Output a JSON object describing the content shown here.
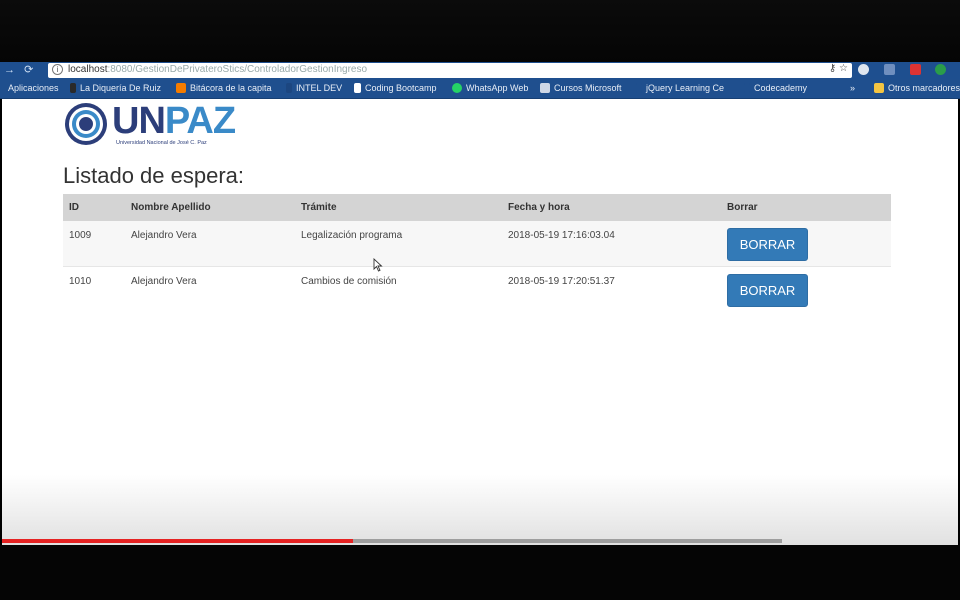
{
  "browser": {
    "url_host": "localhost",
    "url_path": ":8080/GestionDePrivateroStics/ControladorGestionIngreso",
    "bookmarks": [
      {
        "label": "Aplicaciones",
        "icon": "apps-grid-icon"
      },
      {
        "label": "La Diquería De Ruiz",
        "icon": "bookmark-icon"
      },
      {
        "label": "Bitácora de la capita",
        "icon": "blogger-icon"
      },
      {
        "label": "INTEL DEV",
        "icon": "intel-icon"
      },
      {
        "label": "Coding Bootcamp",
        "icon": "page-icon"
      },
      {
        "label": "WhatsApp Web",
        "icon": "whatsapp-icon"
      },
      {
        "label": "Cursos Microsoft",
        "icon": "microsoft-icon"
      },
      {
        "label": "jQuery Learning Ce",
        "icon": "jquery-icon"
      },
      {
        "label": "Codecademy",
        "icon": "codecademy-icon"
      },
      {
        "label": "»",
        "icon": ""
      },
      {
        "label": "Otros marcadores",
        "icon": "folder-icon"
      }
    ]
  },
  "logo": {
    "unpaz_un": "UN",
    "unpaz_paz": "PAZ",
    "subtitle": "Universidad Nacional de José C. Paz"
  },
  "page": {
    "title": "Listado de espera:"
  },
  "table": {
    "headers": [
      "ID",
      "Nombre Apellido",
      "Trámite",
      "Fecha y hora",
      "Borrar"
    ],
    "rows": [
      {
        "id": "1009",
        "name": "Alejandro Vera",
        "tramite": "Legalización programa",
        "fecha": "2018-05-19 17:16:03.04",
        "button": "BORRAR"
      },
      {
        "id": "1010",
        "name": "Alejandro Vera",
        "tramite": "Cambios de comisión",
        "fecha": "2018-05-19 17:20:51.37",
        "button": "BORRAR"
      }
    ]
  },
  "video": {
    "progress": 0.45
  },
  "colors": {
    "button": "#337ab7",
    "header_bg": "#d4d4d4",
    "logo_dark": "#2c3e7a",
    "logo_light": "#3a8ac8",
    "progress": "#e52222"
  }
}
